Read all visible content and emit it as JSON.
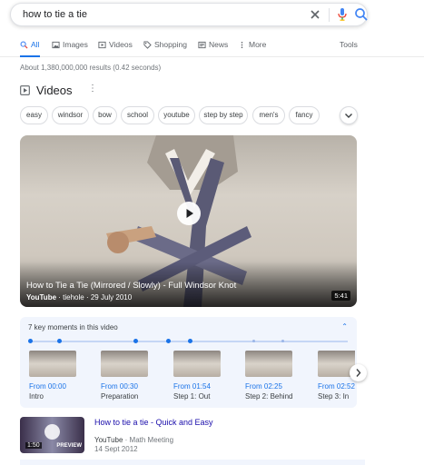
{
  "search": {
    "query": "how to tie a tie"
  },
  "tabs": [
    {
      "label": "All",
      "icon": "search-icon"
    },
    {
      "label": "Images",
      "icon": "image-icon"
    },
    {
      "label": "Videos",
      "icon": "video-icon"
    },
    {
      "label": "Shopping",
      "icon": "tag-icon"
    },
    {
      "label": "News",
      "icon": "news-icon"
    },
    {
      "label": "More",
      "icon": "more-vert-icon"
    }
  ],
  "tools_label": "Tools",
  "stats": "About 1,380,000,000 results (0.42 seconds)",
  "videos_heading": "Videos",
  "chips": [
    "easy",
    "windsor",
    "bow",
    "school",
    "youtube",
    "step by step",
    "men's",
    "fancy"
  ],
  "featured_video": {
    "title": "How to Tie a Tie (Mirrored / Slowly) - Full Windsor Knot",
    "source": "YouTube",
    "channel": "tiehole",
    "date": "29 July 2010",
    "duration": "5:41"
  },
  "key_moments": {
    "heading": "7 key moments in this video",
    "items": [
      {
        "from": "From 00:00",
        "label": "Intro"
      },
      {
        "from": "From 00:30",
        "label": "Preparation"
      },
      {
        "from": "From 01:54",
        "label": "Step 1: Out"
      },
      {
        "from": "From 02:25",
        "label": "Step 2: Behind"
      },
      {
        "from": "From 02:52",
        "label": "Step 3: In"
      }
    ]
  },
  "second_result": {
    "title": "How to tie a tie - Quick and Easy",
    "source": "YouTube",
    "channel": "Math Meeting",
    "date": "14 Sept 2012",
    "duration": "1:50",
    "preview_label": "PREVIEW"
  },
  "colors": {
    "accent": "#1a73e8",
    "link": "#1a0dab",
    "keymoments_bg": "#f1f5fd"
  }
}
